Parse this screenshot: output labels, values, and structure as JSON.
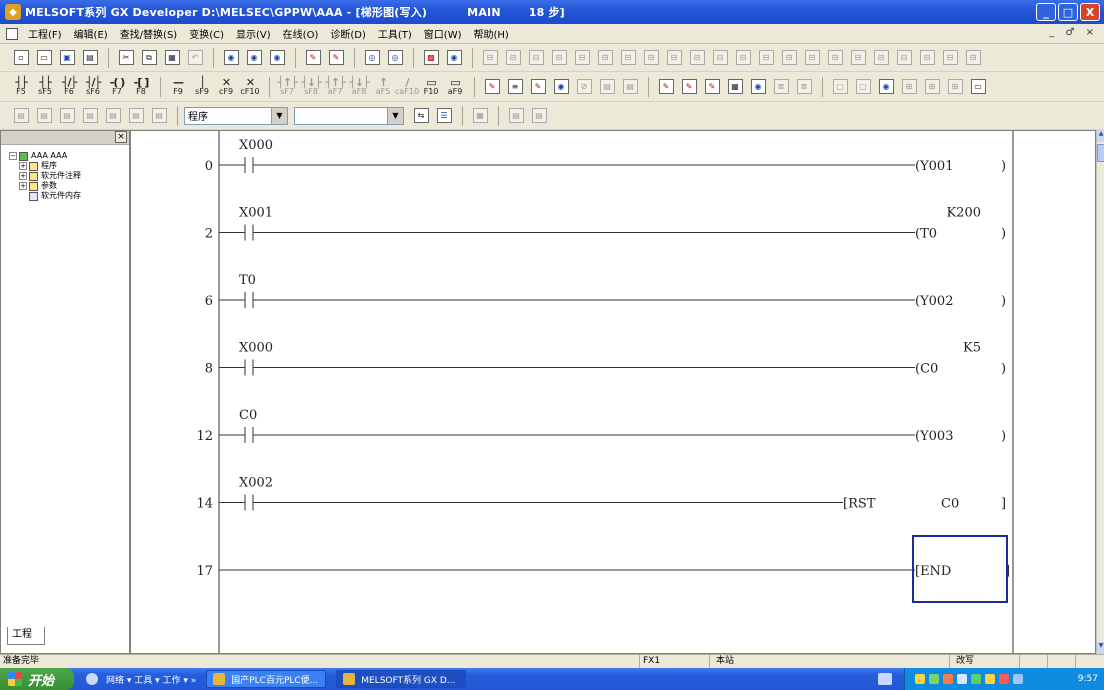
{
  "window": {
    "title": "MELSOFT系列 GX Developer D:\\MELSEC\\GPPW\\AAA - [梯形图(写入)",
    "mode": "MAIN",
    "steps": "18 步]",
    "controls": [
      "_",
      "□",
      "X"
    ]
  },
  "menu": {
    "items": [
      "工程(F)",
      "编辑(E)",
      "查找/替换(S)",
      "变换(C)",
      "显示(V)",
      "在线(O)",
      "诊断(D)",
      "工具(T)",
      "窗口(W)",
      "帮助(H)"
    ],
    "mdi_controls": "_ ♂ ×"
  },
  "toolbar3": {
    "program_combo": "程序",
    "device_combo": ""
  },
  "project_tree": {
    "root": "AAA AAA",
    "items": [
      "程序",
      "软元件注释",
      "参数",
      "软元件内存"
    ],
    "tab": "工程"
  },
  "ladder": {
    "rungs": [
      {
        "step": "0",
        "contact": "X000",
        "coil": "(Y001",
        "close": ")",
        "constant": ""
      },
      {
        "step": "2",
        "contact": "X001",
        "coil": "(T0",
        "close": ")",
        "constant": "K200"
      },
      {
        "step": "6",
        "contact": "T0",
        "coil": "(Y002",
        "close": ")",
        "constant": ""
      },
      {
        "step": "8",
        "contact": "X000",
        "coil": "(C0",
        "close": ")",
        "constant": "K5"
      },
      {
        "step": "12",
        "contact": "C0",
        "coil": "(Y003",
        "close": ")",
        "constant": ""
      },
      {
        "step": "14",
        "contact": "X002",
        "coil": "[RST",
        "close": "]",
        "constant": "",
        "operand": "C0"
      },
      {
        "step": "17",
        "contact": "",
        "coil": "[END",
        "close": "]",
        "constant": ""
      }
    ],
    "cursor_color": "#1a2d9c"
  },
  "status": {
    "ready": "准备完毕",
    "cpu": "FX1",
    "station": "本站",
    "mode": "改写"
  },
  "taskbar": {
    "start": "开始",
    "quick_launch": "网络 ▾ 工具 ▾ 工作 ▾ »",
    "tasks": [
      "国产PLC百元PLC便...",
      "MELSOFT系列 GX D..."
    ],
    "time": "9:57"
  }
}
